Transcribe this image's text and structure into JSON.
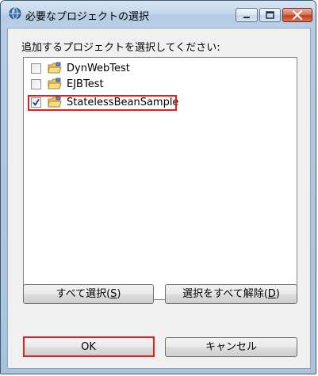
{
  "window": {
    "title": "必要なプロジェクトの選択",
    "title_icon": "eclipse-globe-icon",
    "controls": [
      "minimize-icon",
      "maximize-icon",
      "close-icon"
    ]
  },
  "dialog": {
    "prompt": "追加するプロジェクトを選択してください:",
    "projects": [
      {
        "name": "DynWebTest",
        "checked": false,
        "icon": "project-folder-icon"
      },
      {
        "name": "EJBTest",
        "checked": false,
        "icon": "project-folder-icon"
      },
      {
        "name": "StatelessBeanSample",
        "checked": true,
        "icon": "project-folder-icon"
      }
    ],
    "buttons": {
      "select_all": {
        "text": "すべて選択(",
        "mnemonic": "S",
        "suffix": ")"
      },
      "deselect_all": {
        "text": "選択をすべて解除(",
        "mnemonic": "D",
        "suffix": ")"
      },
      "ok": "OK",
      "cancel": "キャンセル"
    }
  },
  "colors": {
    "highlight": "#e02020",
    "close_button": "#c2401f",
    "titlebar": "#c5d8ec"
  }
}
